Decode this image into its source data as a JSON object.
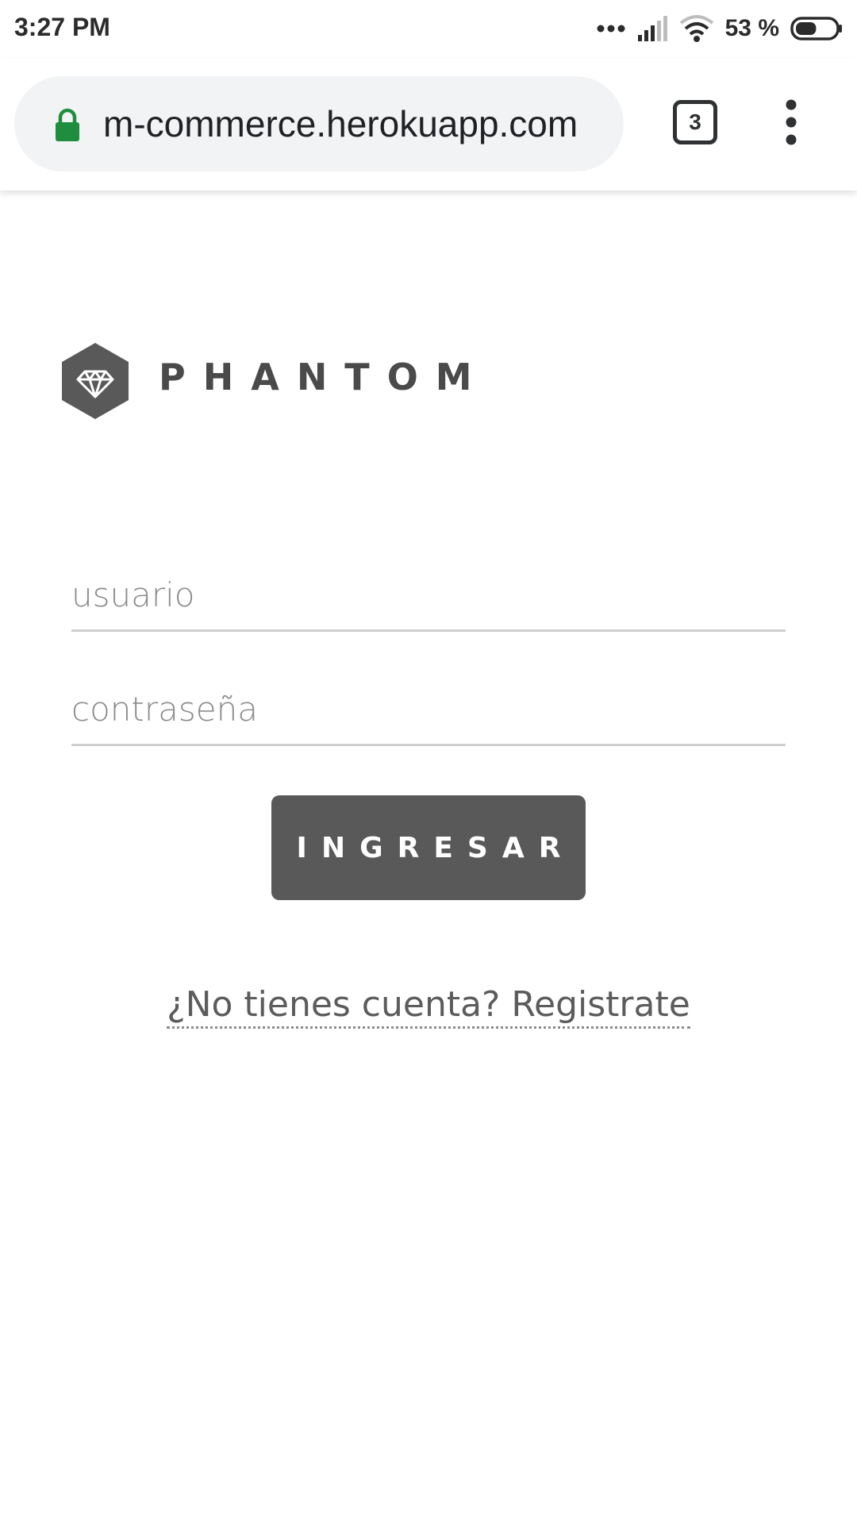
{
  "status_bar": {
    "time": "3:27 PM",
    "battery_percent": "53 %",
    "battery_level": 0.53
  },
  "browser": {
    "url": "m-commerce.herokuapp.com",
    "tab_count": "3",
    "lock_color": "#1e8e3e"
  },
  "brand": {
    "name": "PHANTOM",
    "color": "#595959"
  },
  "login_form": {
    "username_placeholder": "usuario",
    "password_placeholder": "contraseña",
    "submit_label": "INGRESAR",
    "register_link": "¿No tienes cuenta? Registrate"
  },
  "icons": [
    "signal-dots-icon",
    "cell-signal-icon",
    "wifi-icon",
    "battery-icon",
    "lock-icon",
    "tabs-icon",
    "overflow-menu-icon",
    "diamond-logo-icon"
  ]
}
